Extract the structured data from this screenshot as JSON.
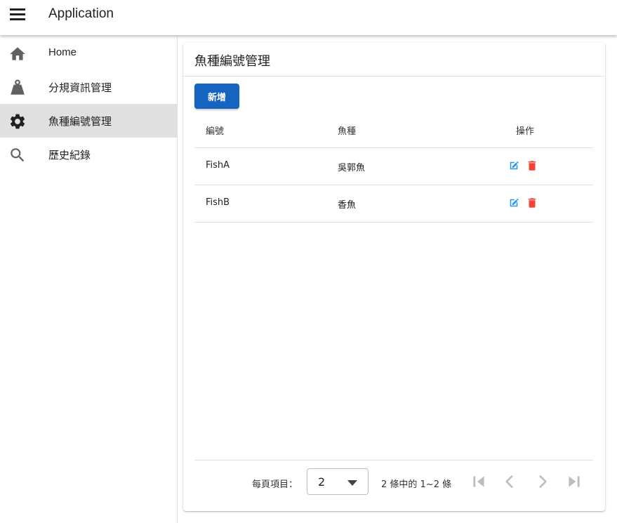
{
  "app": {
    "title": "Application",
    "menu_icon": "hamburger-menu-icon"
  },
  "sidebar": {
    "items": [
      {
        "label": "Home",
        "icon": "home-icon",
        "active": false
      },
      {
        "label": "分規資訊管理",
        "icon": "weight-icon",
        "active": false
      },
      {
        "label": "魚種編號管理",
        "icon": "gear-icon",
        "active": true
      },
      {
        "label": "歷史紀錄",
        "icon": "search-icon",
        "active": false
      }
    ]
  },
  "page": {
    "title": "魚種編號管理",
    "add_button": "新增"
  },
  "table": {
    "headers": [
      "編號",
      "魚種",
      "操作"
    ],
    "rows": [
      {
        "id": "FishA",
        "species": "吳郭魚",
        "edit_icon": "edit-icon",
        "delete_icon": "delete-icon"
      },
      {
        "id": "FishB",
        "species": "香魚",
        "edit_icon": "edit-icon",
        "delete_icon": "delete-icon"
      }
    ]
  },
  "pagination": {
    "rows_per_page_label": "每頁項目：",
    "rows_per_page_value": "2",
    "range_text": "2 條中的 1~2 條",
    "icons": [
      "first-page-icon",
      "previous-page-icon",
      "next-page-icon",
      "last-page-icon"
    ]
  },
  "colors": {
    "primary": "#1565c0",
    "edit": "#2196f3",
    "delete": "#f44336",
    "active_nav_bg": "#e0e0e0",
    "disabled": "#bdbdbd"
  }
}
